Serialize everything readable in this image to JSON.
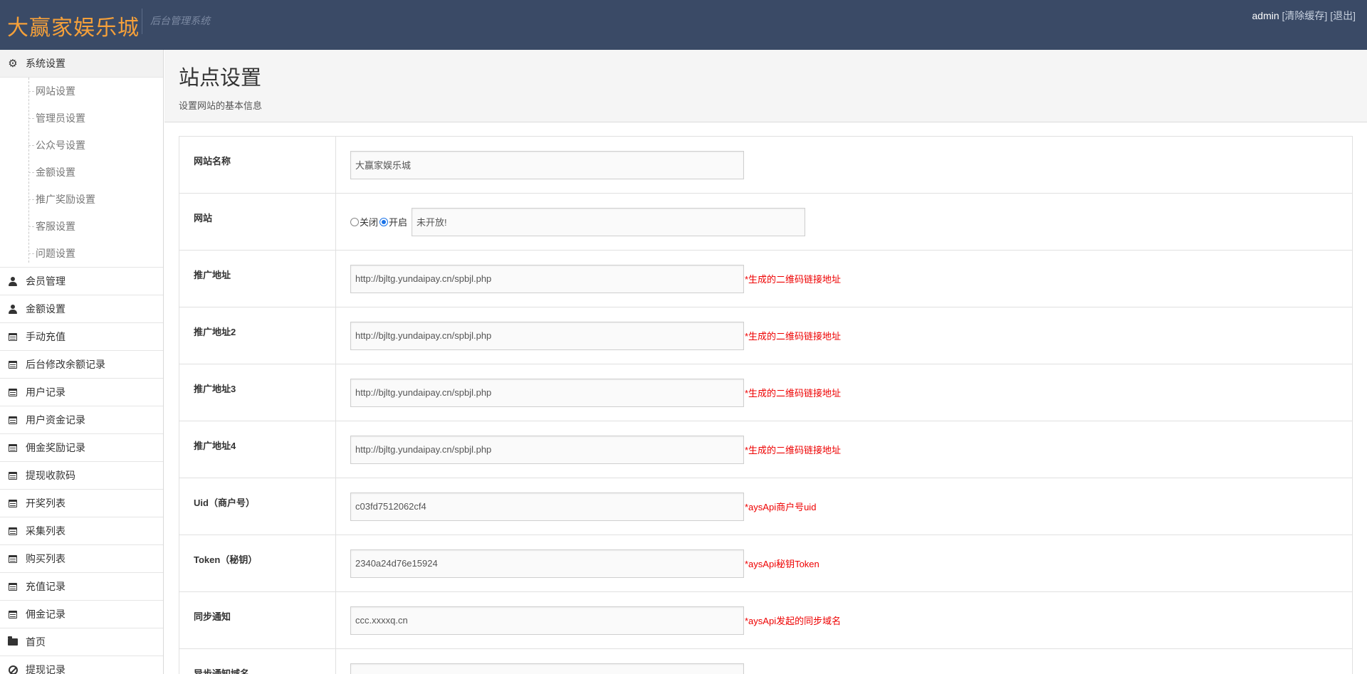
{
  "header": {
    "brand": "大赢家娱乐城",
    "subtitle": "后台管理系统",
    "user": "admin",
    "clear_cache": "[清除缓存]",
    "logout": "[退出]"
  },
  "sidebar": {
    "system_settings": {
      "label": "系统设置",
      "icon": "gear-icon"
    },
    "sub_items": [
      {
        "label": "网站设置"
      },
      {
        "label": "管理员设置"
      },
      {
        "label": "公众号设置"
      },
      {
        "label": "金额设置"
      },
      {
        "label": "推广奖励设置"
      },
      {
        "label": "客服设置"
      },
      {
        "label": "问题设置"
      }
    ],
    "items": [
      {
        "label": "会员管理",
        "icon": "user-icon"
      },
      {
        "label": "金额设置",
        "icon": "user-icon"
      },
      {
        "label": "手动充值",
        "icon": "calendar-icon"
      },
      {
        "label": "后台修改余额记录",
        "icon": "calendar-icon"
      },
      {
        "label": "用户记录",
        "icon": "calendar-icon"
      },
      {
        "label": "用户资金记录",
        "icon": "calendar-icon"
      },
      {
        "label": "佣金奖励记录",
        "icon": "calendar-icon"
      },
      {
        "label": "提现收款码",
        "icon": "calendar-icon"
      },
      {
        "label": "开奖列表",
        "icon": "calendar-icon"
      },
      {
        "label": "采集列表",
        "icon": "calendar-icon"
      },
      {
        "label": "购买列表",
        "icon": "calendar-icon"
      },
      {
        "label": "充值记录",
        "icon": "calendar-icon"
      },
      {
        "label": "佣金记录",
        "icon": "calendar-icon"
      },
      {
        "label": "首页",
        "icon": "folder-open-icon"
      },
      {
        "label": "提现记录",
        "icon": "ban-icon"
      }
    ]
  },
  "page": {
    "title": "站点设置",
    "description": "设置网站的基本信息"
  },
  "form": {
    "site_name": {
      "label": "网站名称",
      "value": "大赢家娱乐城"
    },
    "site_status": {
      "label": "网站",
      "option_off": "关闭",
      "option_on": "开启",
      "selected": "开启",
      "message": "未开放!"
    },
    "promo_url": {
      "label": "推广地址",
      "value": "http://bjltg.yundaipay.cn/spbjl.php",
      "hint": "*生成的二维码链接地址"
    },
    "promo_url2": {
      "label": "推广地址2",
      "value": "http://bjltg.yundaipay.cn/spbjl.php",
      "hint": "*生成的二维码链接地址"
    },
    "promo_url3": {
      "label": "推广地址3",
      "value": "http://bjltg.yundaipay.cn/spbjl.php",
      "hint": "*生成的二维码链接地址"
    },
    "promo_url4": {
      "label": "推广地址4",
      "value": "http://bjltg.yundaipay.cn/spbjl.php",
      "hint": "*生成的二维码链接地址"
    },
    "uid": {
      "label": "Uid（商户号）",
      "value": "c03fd7512062cf4",
      "hint": "*aysApi商户号uid"
    },
    "token": {
      "label": "Token（秘钥）",
      "value": "2340a24d76e15924",
      "hint": "*aysApi秘钥Token"
    },
    "sync_notify": {
      "label": "同步通知",
      "value": "ccc.xxxxq.cn",
      "hint": "*aysApi发起的同步域名"
    },
    "async_notify": {
      "label": "异步通知域名"
    }
  },
  "colors": {
    "header_bg": "#3a4a66",
    "brand": "#f5a03a",
    "hint": "#ee0000"
  }
}
